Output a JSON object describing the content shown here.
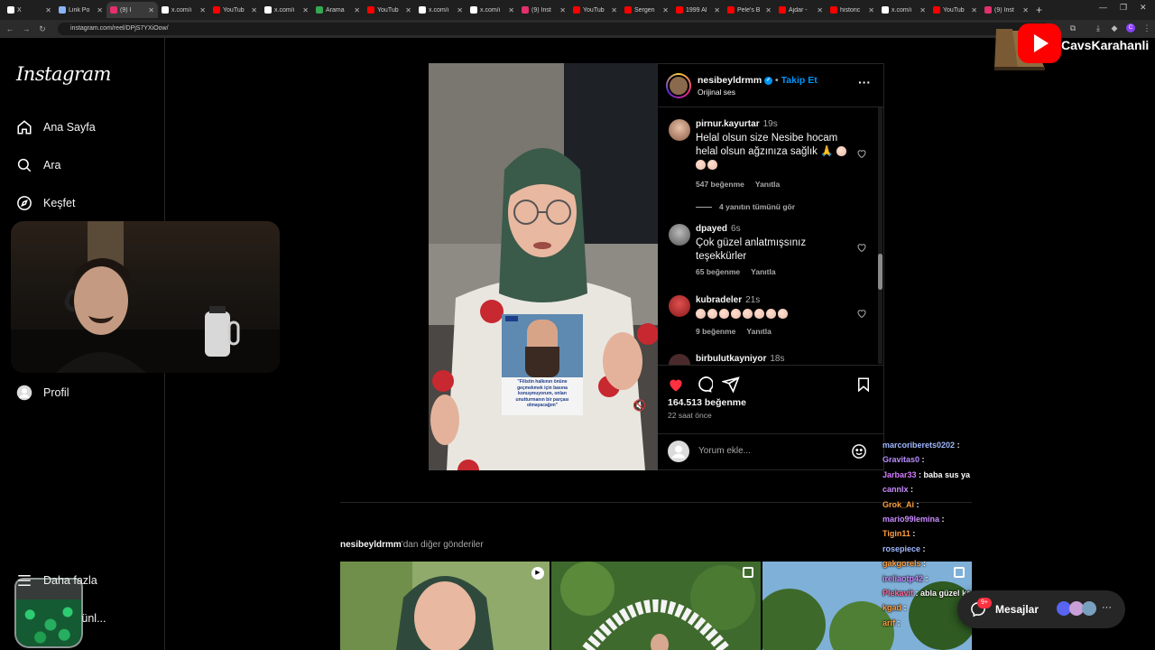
{
  "browser": {
    "tabs": [
      {
        "title": "X",
        "color": "#ffffff"
      },
      {
        "title": "Link Po",
        "color": "#8ab4f8"
      },
      {
        "title": "(9) I",
        "color": "#e1306c",
        "active": true
      },
      {
        "title": "x.com/i",
        "color": "#ffffff"
      },
      {
        "title": "YouTub",
        "color": "#ff0000"
      },
      {
        "title": "x.com/i",
        "color": "#ffffff"
      },
      {
        "title": "Arama",
        "color": "#34a853"
      },
      {
        "title": "YouTub",
        "color": "#ff0000"
      },
      {
        "title": "x.com/i",
        "color": "#ffffff"
      },
      {
        "title": "x.com/i",
        "color": "#ffffff"
      },
      {
        "title": "(9) Inst",
        "color": "#e1306c"
      },
      {
        "title": "YouTub",
        "color": "#ff0000"
      },
      {
        "title": "Sergen",
        "color": "#ff0000"
      },
      {
        "title": "1999 Al",
        "color": "#ff0000"
      },
      {
        "title": "Pele's B",
        "color": "#ff0000"
      },
      {
        "title": "Ajdar -",
        "color": "#ff0000"
      },
      {
        "title": "historic",
        "color": "#ff0000"
      },
      {
        "title": "x.com/i",
        "color": "#ffffff"
      },
      {
        "title": "YouTub",
        "color": "#ff0000"
      },
      {
        "title": "(9) Inst",
        "color": "#e1306c"
      }
    ],
    "url": "instagram.com/reel/DPjS7YXiOow/"
  },
  "sidebar": {
    "logo": "Instagram",
    "items": [
      {
        "label": "Ana Sayfa",
        "icon": "home-icon"
      },
      {
        "label": "Ara",
        "icon": "search-icon"
      },
      {
        "label": "Keşfet",
        "icon": "compass-icon"
      },
      {
        "label": "Profil",
        "icon": "avatar-icon"
      },
      {
        "label": "Daha fazla",
        "icon": "menu-icon"
      },
      {
        "label": "diğer ürünl...",
        "icon": "meta-icon"
      }
    ]
  },
  "reel": {
    "username": "nesibeyldrmm",
    "follow_label": "Takip Et",
    "audio": "Orijinal ses",
    "inset_quote": "\"Filistin halkının önüne geçmekmek için basına konuşmuyorum, onları unutturmanın bir parçası olmayacağım\"",
    "comments": [
      {
        "user": "pirnur.kayurtar",
        "time": "19s",
        "text": "Helal olsun size Nesibe hocam helal olsun ağzınıza sağlık",
        "likes": "547 beğenme",
        "reply": "Yanıtla",
        "view_replies": "4 yanıtın tümünü gör"
      },
      {
        "user": "dpayed",
        "time": "6s",
        "text": "Çok güzel anlatmışsınız teşekkürler",
        "likes": "65 beğenme",
        "reply": "Yanıtla"
      },
      {
        "user": "kubradeler",
        "time": "21s",
        "text": "",
        "likes": "9 beğenme",
        "reply": "Yanıtla"
      },
      {
        "user": "birbulutkayniyor",
        "time": "18s",
        "text": ""
      }
    ],
    "like_count": "164.513 beğenme",
    "posted": "22 saat önce",
    "comment_placeholder": "Yorum ekle..."
  },
  "more_posts": {
    "username": "nesibeyldrmm",
    "suffix": "'dan diğer gönderiler"
  },
  "stream": {
    "channel": "CavsKarahanli",
    "chat": [
      {
        "user": "marcoriberets0202",
        "msg": "",
        "color": "#9fb8ff"
      },
      {
        "user": "Gravitas0",
        "msg": "",
        "color": "#b98cff"
      },
      {
        "user": "Jarbar33",
        "msg": "baba sus ya",
        "color": "#d47cff"
      },
      {
        "user": "cannlx",
        "msg": "",
        "color": "#c98bff"
      },
      {
        "user": "Grok_Ai",
        "msg": "",
        "color": "#ff9f40"
      },
      {
        "user": "mario99lemina",
        "msg": "",
        "color": "#c98bff"
      },
      {
        "user": "Tigin11",
        "msg": "",
        "color": "#ff9f40"
      },
      {
        "user": "rosepiece",
        "msg": "",
        "color": "#9fb8ff"
      },
      {
        "user": "gakgorels",
        "msg": "",
        "color": "#ff9f40"
      },
      {
        "user": "ireliaotp42",
        "msg": "",
        "color": "#c98bff"
      },
      {
        "user": "Plekavit",
        "msg": "abla güzel konuşmuş ya",
        "color": "#ff6b9d"
      },
      {
        "user": "kgad",
        "msg": "",
        "color": "#ff9f40"
      },
      {
        "user": "arif",
        "msg": "",
        "color": "#ff9f40"
      }
    ]
  },
  "messages": {
    "label": "Mesajlar",
    "badge": "9+"
  }
}
